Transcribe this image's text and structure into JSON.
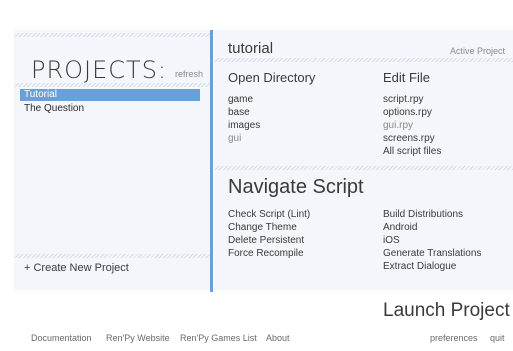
{
  "projects": {
    "title": "PROJECTS:",
    "refresh_label": "refresh",
    "items": [
      "Tutorial",
      "The Question"
    ],
    "create_label": "+ Create New Project"
  },
  "project": {
    "name": "tutorial",
    "active_label": "Active Project"
  },
  "open_directory": {
    "heading": "Open Directory",
    "items": [
      "game",
      "base",
      "images",
      "gui"
    ]
  },
  "edit_file": {
    "heading": "Edit File",
    "items": [
      "script.rpy",
      "options.rpy",
      "gui.rpy",
      "screens.rpy",
      "All script files"
    ]
  },
  "navigate": {
    "heading": "Navigate Script",
    "left_items": [
      "Check Script (Lint)",
      "Change Theme",
      "Delete Persistent",
      "Force Recompile"
    ],
    "right_items": [
      "Build Distributions",
      "Android",
      "iOS",
      "Generate Translations",
      "Extract Dialogue"
    ]
  },
  "launch_label": "Launch Project",
  "footer": {
    "links": [
      "Documentation",
      "Ren'Py Website",
      "Ren'Py Games List",
      "About"
    ],
    "preferences": "preferences",
    "quit": "quit"
  },
  "colors": {
    "accent": "#6aa0d8",
    "panel": "#f3f6fa"
  }
}
